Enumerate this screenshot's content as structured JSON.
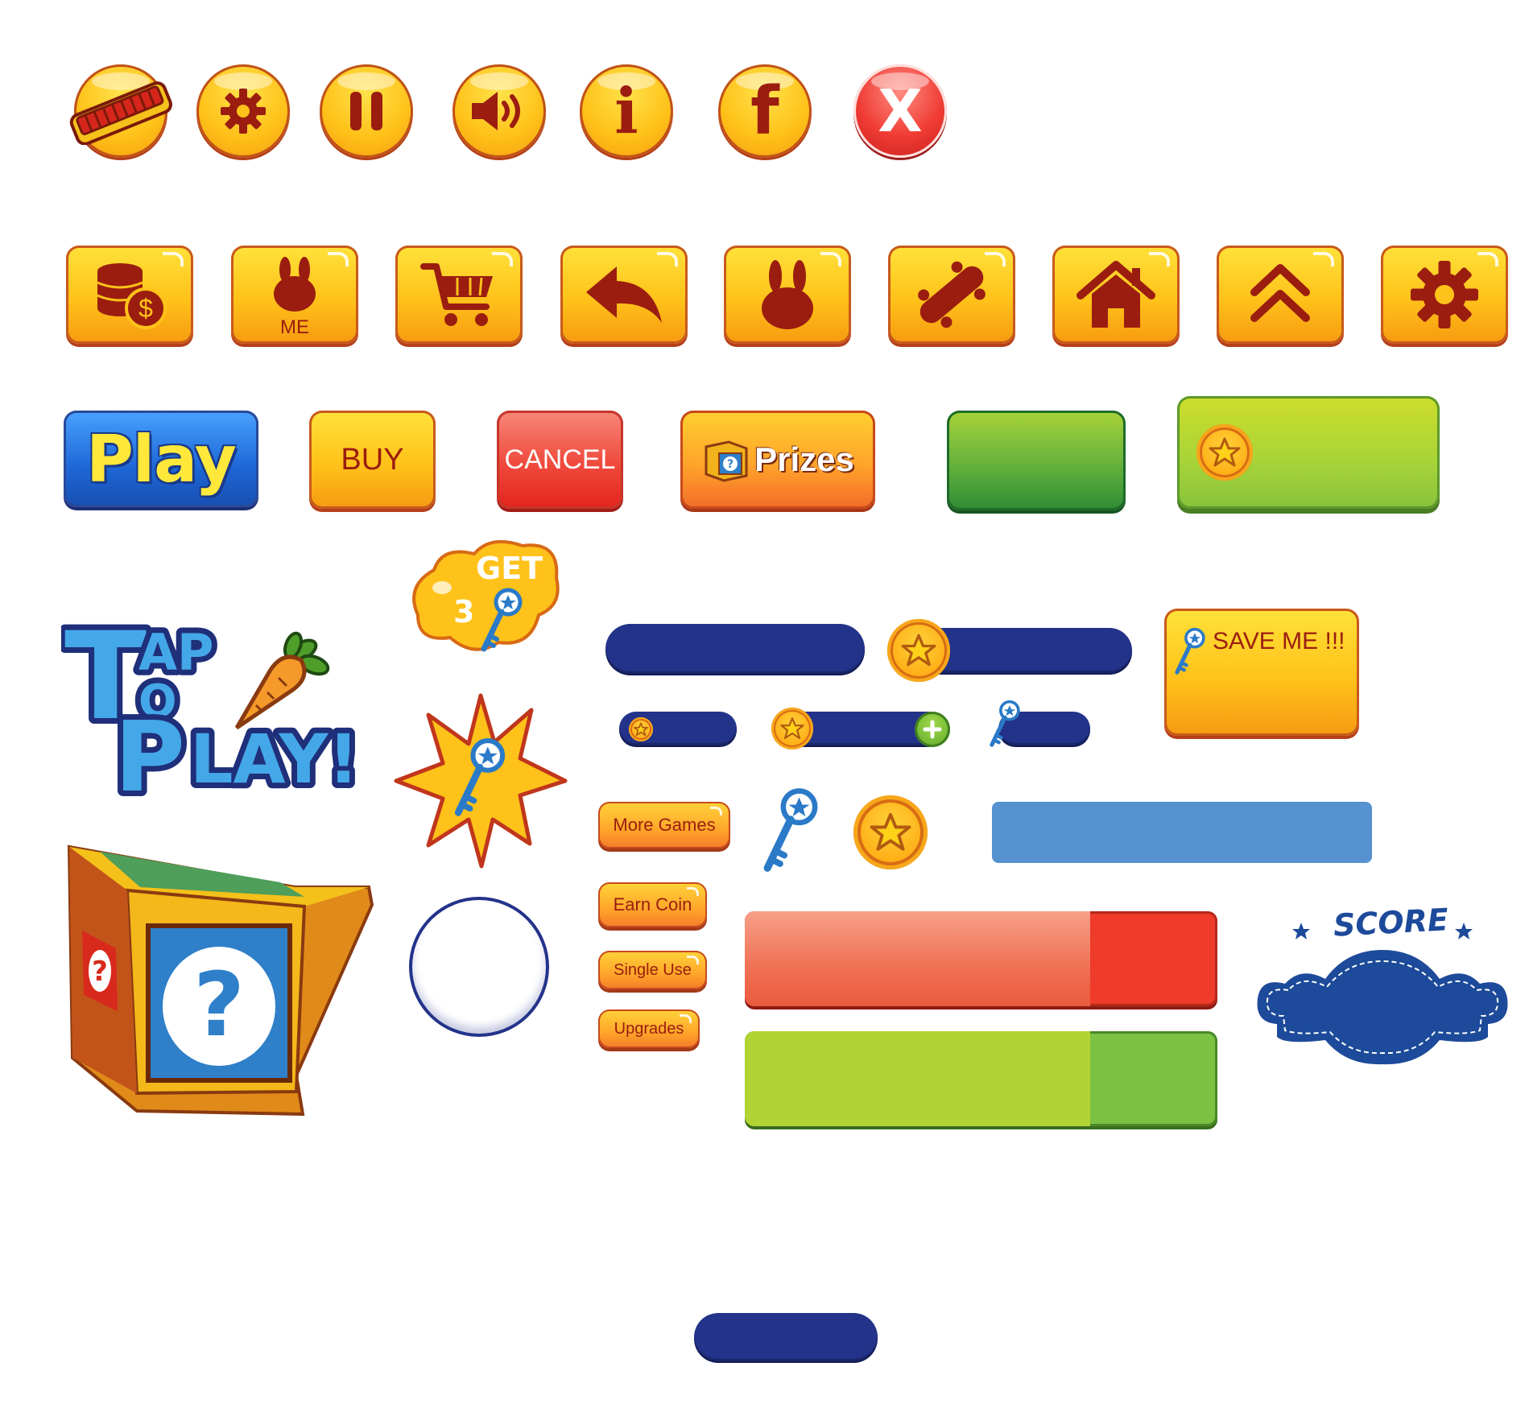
{
  "round_buttons": [
    {
      "icon": "harmonica-icon"
    },
    {
      "icon": "gear-icon"
    },
    {
      "icon": "pause-icon"
    },
    {
      "icon": "speaker-icon"
    },
    {
      "icon": "info-icon",
      "glyph": "i"
    },
    {
      "icon": "facebook-icon",
      "glyph": "f"
    },
    {
      "icon": "close-icon",
      "glyph": "X"
    }
  ],
  "square_buttons": [
    {
      "icon": "coins-dollar-icon"
    },
    {
      "icon": "bunny-icon",
      "label": "ME"
    },
    {
      "icon": "cart-icon"
    },
    {
      "icon": "back-arrow-icon"
    },
    {
      "icon": "bunny-icon"
    },
    {
      "icon": "skateboard-icon"
    },
    {
      "icon": "home-icon"
    },
    {
      "icon": "double-chevron-up-icon"
    },
    {
      "icon": "gear-icon"
    }
  ],
  "wide_buttons": {
    "play": "Play",
    "buy": "BUY",
    "cancel": "CANCEL",
    "prizes": "Prizes"
  },
  "logo": {
    "line1": "AP",
    "line2": "O",
    "line3": "LAY!",
    "initial1": "T",
    "initial3": "P"
  },
  "get_bubble": {
    "get": "GET",
    "count": "3"
  },
  "save_me": "SAVE ME !!!",
  "text_buttons": {
    "more_games": "More Games",
    "earn_coin": "Earn Coin",
    "single_use": "Single Use",
    "upgrades": "Upgrades"
  },
  "score_label": "SCORE",
  "progress": {
    "red_fill": 0.73,
    "green_fill": 0.73
  },
  "colors": {
    "navy": "#23338a",
    "yellow": "#ffc21a",
    "red_text": "#9b1d10",
    "light_blue": "#5592cf",
    "red_bar": "#ef4a3c",
    "green_bar": "#b1d334"
  }
}
